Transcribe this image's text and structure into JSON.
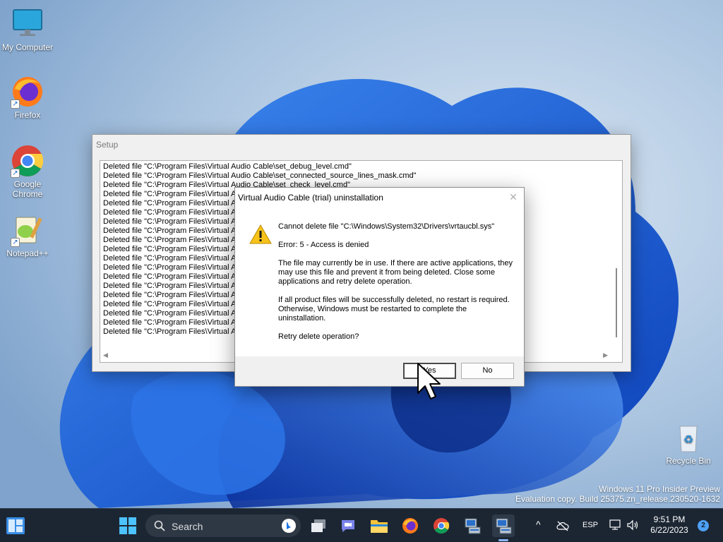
{
  "desktop": {
    "icons": [
      {
        "label": "My Computer"
      },
      {
        "label": "Firefox"
      },
      {
        "label": "Google\nChrome"
      },
      {
        "label": "Notepad++"
      },
      {
        "label": "Recycle Bin"
      }
    ],
    "watermark": {
      "line1": "Windows 11 Pro Insider Preview",
      "line2": "Evaluation copy. Build 25375.zn_release.230520-1632"
    }
  },
  "setup_window": {
    "title": "Setup",
    "log_lines": [
      "Deleted file \"C:\\Program Files\\Virtual Audio Cable\\set_debug_level.cmd\"",
      "Deleted file \"C:\\Program Files\\Virtual Audio Cable\\set_connected_source_lines_mask.cmd\"",
      "Deleted file \"C:\\Program Files\\Virtual Audio Cable\\set_check_level.cmd\"",
      "Deleted file \"C:\\Program Files\\Virtual Au",
      "Deleted file \"C:\\Program Files\\Virtual Au",
      "Deleted file \"C:\\Program Files\\Virtual Au",
      "Deleted file \"C:\\Program Files\\Virtual Au",
      "Deleted file \"C:\\Program Files\\Virtual Au",
      "Deleted file \"C:\\Program Files\\Virtual Au",
      "Deleted file \"C:\\Program Files\\Virtual Au",
      "Deleted file \"C:\\Program Files\\Virtual Au",
      "Deleted file \"C:\\Program Files\\Virtual Au",
      "Deleted file \"C:\\Program Files\\Virtual Au",
      "Deleted file \"C:\\Program Files\\Virtual Au",
      "Deleted file \"C:\\Program Files\\Virtual Au",
      "Deleted file \"C:\\Program Files\\Virtual Au",
      "Deleted file \"C:\\Program Files\\Virtual Au",
      "Deleted file \"C:\\Program Files\\Virtual Au",
      "Deleted file \"C:\\Program Files\\Virtual Au"
    ]
  },
  "dialog": {
    "title": "Virtual Audio Cable (trial) uninstallation",
    "close_glyph": "✕",
    "icon": "warning-icon",
    "message_line1": "Cannot delete file \"C:\\Windows\\System32\\Drivers\\vrtaucbl.sys\"",
    "message_line2": "Error: 5 - Access is denied",
    "message_line3": "The file may currently be in use. If there are active applications, they may use this file and prevent it from being deleted. Close some applications and retry delete operation.",
    "message_line4": "If all product files will be successfully deleted, no restart is required. Otherwise, Windows must be restarted to complete the uninstallation.",
    "message_line5": "Retry delete operation?",
    "yes_label": "Yes",
    "no_label": "No"
  },
  "taskbar": {
    "search_label": "Search",
    "icons": [
      "widgets-icon",
      "start-icon",
      "search-icon",
      "bing-icon",
      "task-view-icon",
      "chat-icon",
      "file-explorer-icon",
      "firefox-icon",
      "chrome-icon",
      "setup-app-icon",
      "setup-app-icon-active"
    ],
    "tray": {
      "chevron": "^",
      "language": "ESP",
      "time": "9:51 PM",
      "date": "6/22/2023",
      "notifications": "2"
    }
  },
  "colors": {
    "taskbar_bg": "#1c2633",
    "dialog_footer": "#f0f0f0",
    "wallpaper_blue": "#1a5fd6"
  }
}
